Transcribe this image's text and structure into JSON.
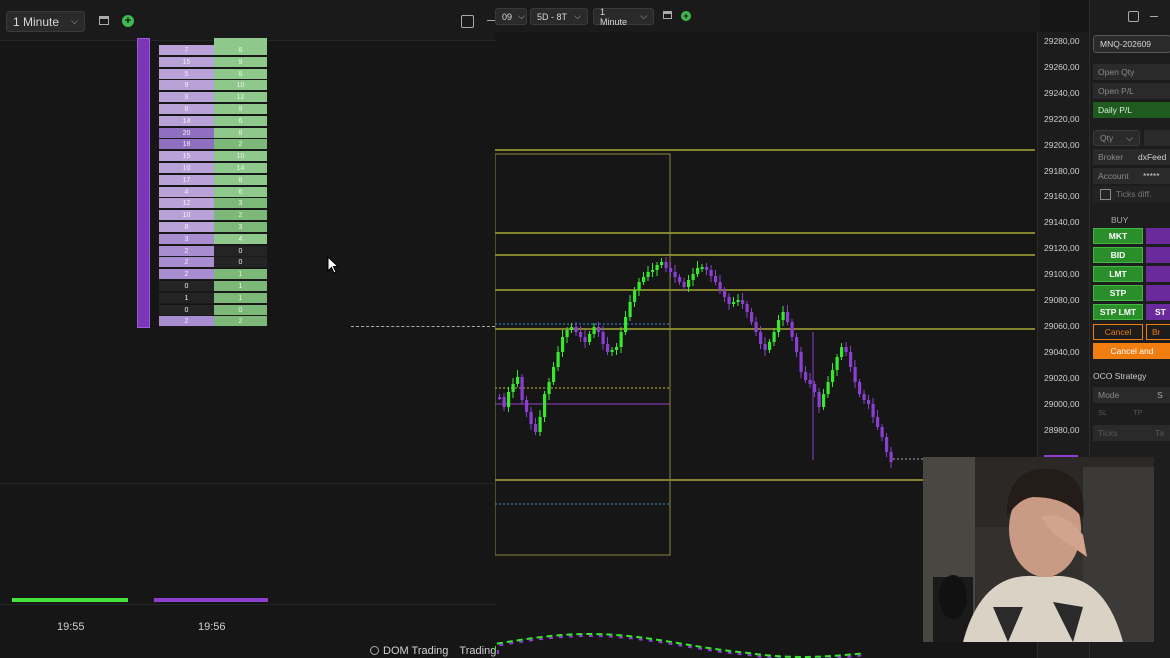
{
  "left_toolbar": {
    "timeframe": "1 Minute"
  },
  "right_toolbar": {
    "symbol_partial": "09",
    "range": "5D - 8T",
    "timeframe": "1 Minute"
  },
  "dom_rows": [
    [
      "7",
      "6"
    ],
    [
      "15",
      "9"
    ],
    [
      "5",
      "6"
    ],
    [
      "9",
      "10"
    ],
    [
      "9",
      "12"
    ],
    [
      "8",
      "9"
    ],
    [
      "14",
      "6"
    ],
    [
      "20",
      "8"
    ],
    [
      "18",
      "2"
    ],
    [
      "15",
      "10"
    ],
    [
      "10",
      "14"
    ],
    [
      "17",
      "8"
    ],
    [
      "4",
      "6"
    ],
    [
      "12",
      "3"
    ],
    [
      "10",
      "2"
    ],
    [
      "8",
      "3"
    ],
    [
      "3",
      "4"
    ],
    [
      "2",
      "0"
    ],
    [
      "2",
      "0"
    ],
    [
      "2",
      "1"
    ],
    [
      "0",
      "1"
    ],
    [
      "1",
      "1"
    ],
    [
      "0",
      "0"
    ],
    [
      "2",
      "2"
    ]
  ],
  "times": [
    "19:55",
    "19:56"
  ],
  "bottom_tabs": {
    "dom": "DOM Trading",
    "trading": "Trading"
  },
  "price_axis": [
    "29280,00",
    "29260,00",
    "29240,00",
    "29220,00",
    "29200,00",
    "29180,00",
    "29160,00",
    "29140,00",
    "29120,00",
    "29100,00",
    "29080,00",
    "29060,00",
    "29040,00",
    "29020,00",
    "29000,00",
    "28980,00"
  ],
  "order_panel": {
    "contract": "MNQ-202609",
    "open_qty": "Open Qty",
    "open_pl": "Open P/L",
    "daily_pl": "Daily P/L",
    "qty": "Qty",
    "broker_label": "Broker",
    "broker_value": "dxFeed",
    "account_label": "Account",
    "account_value": "*****",
    "ticks_diff": "Ticks diff.",
    "buy_label": "BUY",
    "mkt": "MKT",
    "bid": "BID",
    "lmt": "LMT",
    "stp": "STP",
    "stp_lmt": "STP LMT",
    "stp_sell_partial": "ST",
    "cancel": "Cancel",
    "br_partial": "Br",
    "cancel_and": "Cancel and",
    "oco_strategy": "OCO Strategy",
    "mode": "Mode",
    "mode_partial": "S",
    "sl_partial": "SL",
    "tp_partial": "TP",
    "ticks": "Ticks",
    "ta_partial": "Ta"
  },
  "colors": {
    "bull": "#37e82c",
    "bear": "#8a3fd1",
    "level": "#c8c23e",
    "accent_orange": "#f07d10",
    "buy_green": "#2a8f2a"
  }
}
